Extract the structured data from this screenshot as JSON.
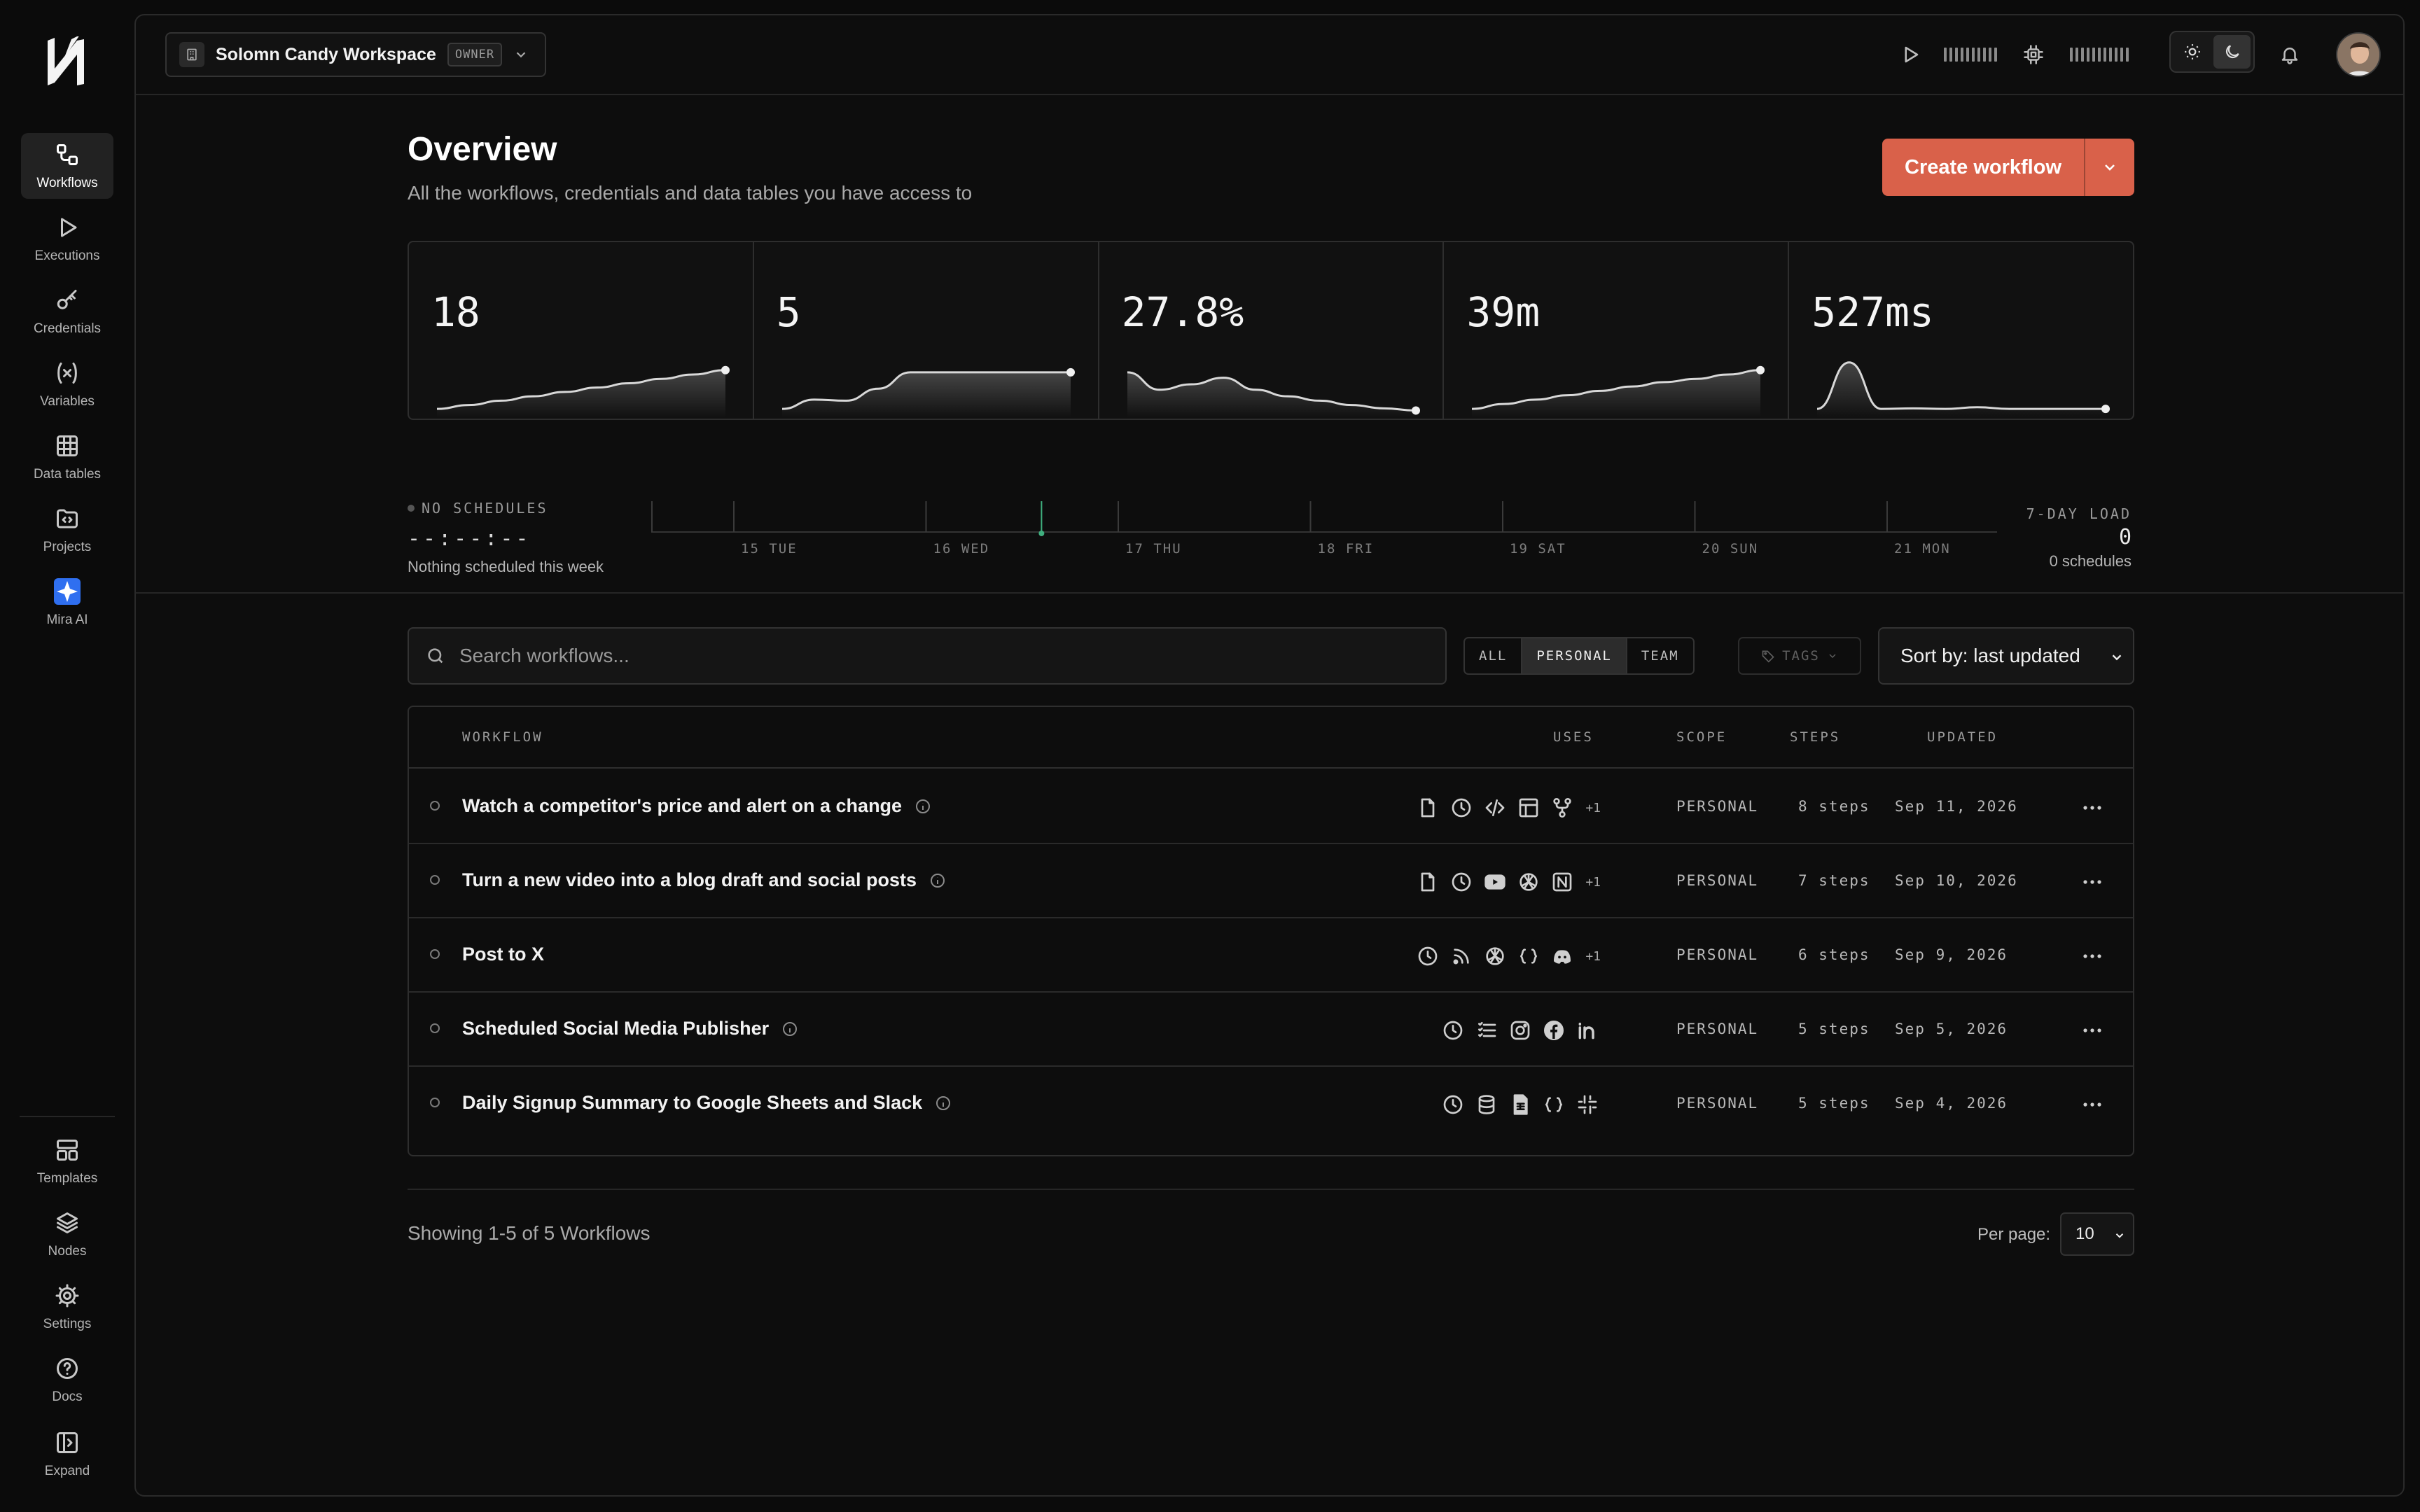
{
  "sidebar": {
    "items": [
      {
        "label": "Workflows",
        "icon": "workflows-icon"
      },
      {
        "label": "Executions",
        "icon": "play-icon"
      },
      {
        "label": "Credentials",
        "icon": "key-icon"
      },
      {
        "label": "Variables",
        "icon": "variables-icon"
      },
      {
        "label": "Data tables",
        "icon": "table-icon"
      },
      {
        "label": "Projects",
        "icon": "folder-code-icon"
      },
      {
        "label": "Mira AI",
        "icon": "sparkle-icon"
      }
    ],
    "bottom": [
      {
        "label": "Templates",
        "icon": "layout-icon"
      },
      {
        "label": "Nodes",
        "icon": "layers-icon"
      },
      {
        "label": "Settings",
        "icon": "gear-icon"
      },
      {
        "label": "Docs",
        "icon": "help-icon"
      },
      {
        "label": "Expand",
        "icon": "expand-panel-icon"
      }
    ]
  },
  "workspace": {
    "name": "Solomn Candy Workspace",
    "role": "OWNER"
  },
  "page": {
    "title": "Overview",
    "subtitle": "All the workflows, credentials and data tables you have access to",
    "create_label": "Create workflow"
  },
  "metrics": [
    {
      "value": "18",
      "trend": [
        0.05,
        0.12,
        0.2,
        0.28,
        0.36,
        0.44,
        0.52,
        0.6,
        0.68,
        0.76
      ]
    },
    {
      "value": "5",
      "trend": [
        0.05,
        0.22,
        0.2,
        0.42,
        0.72,
        0.72,
        0.72,
        0.72,
        0.72,
        0.72
      ]
    },
    {
      "value": "27.8%",
      "trend": [
        0.72,
        0.4,
        0.5,
        0.62,
        0.4,
        0.28,
        0.2,
        0.12,
        0.06,
        0.02
      ]
    },
    {
      "value": "39m",
      "trend": [
        0.05,
        0.14,
        0.22,
        0.3,
        0.38,
        0.46,
        0.54,
        0.6,
        0.68,
        0.76
      ]
    },
    {
      "value": "527ms",
      "trend": [
        0.05,
        0.9,
        0.05,
        0.06,
        0.05,
        0.08,
        0.05,
        0.05,
        0.05,
        0.05
      ]
    }
  ],
  "schedule": {
    "status": "NO SCHEDULES",
    "next_time": "--:--:--",
    "note": "Nothing scheduled this week",
    "days": [
      "15 TUE",
      "16 WED",
      "17 THU",
      "18 FRI",
      "19 SAT",
      "20 SUN",
      "21 MON"
    ],
    "now_fraction": 0.29,
    "load_label": "7-DAY LOAD",
    "load_value": "0",
    "load_sub": "0 schedules"
  },
  "filters": {
    "search_placeholder": "Search workflows...",
    "segments": [
      "ALL",
      "PERSONAL",
      "TEAM"
    ],
    "active_segment": "PERSONAL",
    "tags_label": "TAGS",
    "sort_label": "Sort by: last updated"
  },
  "table": {
    "headers": {
      "workflow": "WORKFLOW",
      "uses": "USES",
      "scope": "SCOPE",
      "steps": "STEPS",
      "updated": "UPDATED"
    },
    "rows": [
      {
        "name": "Watch a competitor's price and alert on a change",
        "info": true,
        "uses": [
          "file-icon",
          "clock-icon",
          "code-icon",
          "table-icon",
          "git-fork-icon"
        ],
        "more": "+1",
        "scope": "PERSONAL",
        "steps": "8 steps",
        "updated": "Sep 11, 2026"
      },
      {
        "name": "Turn a new video into a blog draft and social posts",
        "info": true,
        "uses": [
          "file-icon",
          "clock-icon",
          "youtube-icon",
          "openai-icon",
          "notion-icon"
        ],
        "more": "+1",
        "scope": "PERSONAL",
        "steps": "7 steps",
        "updated": "Sep 10, 2026"
      },
      {
        "name": "Post to X",
        "info": false,
        "uses": [
          "clock-icon",
          "rss-icon",
          "openai-icon",
          "braces-icon",
          "discord-icon"
        ],
        "more": "+1",
        "scope": "PERSONAL",
        "steps": "6 steps",
        "updated": "Sep 9, 2026"
      },
      {
        "name": "Scheduled Social Media Publisher",
        "info": true,
        "uses": [
          "clock-icon",
          "list-icon",
          "instagram-icon",
          "facebook-icon",
          "linkedin-icon"
        ],
        "more": "",
        "scope": "PERSONAL",
        "steps": "5 steps",
        "updated": "Sep 5, 2026"
      },
      {
        "name": "Daily Signup Summary to Google Sheets and Slack",
        "info": true,
        "uses": [
          "clock-icon",
          "database-icon",
          "sheet-icon",
          "braces-icon",
          "slack-icon"
        ],
        "more": "",
        "scope": "PERSONAL",
        "steps": "5 steps",
        "updated": "Sep 4, 2026"
      }
    ]
  },
  "footer": {
    "showing": "Showing 1-5 of 5 Workflows",
    "per_page_label": "Per page:",
    "per_page_value": "10"
  },
  "colors": {
    "accent": "#d9614a",
    "mira": "#2f6ff0",
    "now_marker": "#3fae7e"
  }
}
